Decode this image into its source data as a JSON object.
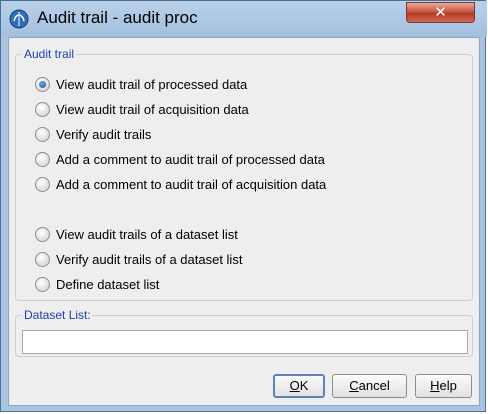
{
  "window": {
    "title": "Audit trail - audit proc",
    "close_label": "✕"
  },
  "audit_group": {
    "title": "Audit trail",
    "options": [
      {
        "label": "View audit trail of processed data",
        "selected": true
      },
      {
        "label": "View audit trail of acquisition data",
        "selected": false
      },
      {
        "label": "Verify audit trails",
        "selected": false
      },
      {
        "label": "Add a comment to audit trail of processed data",
        "selected": false
      },
      {
        "label": "Add a comment to audit trail of acquisition data",
        "selected": false
      },
      {
        "label": "View audit trails of a dataset list",
        "selected": false
      },
      {
        "label": "Verify audit trails of a dataset list",
        "selected": false
      },
      {
        "label": "Define dataset list",
        "selected": false
      }
    ]
  },
  "dataset_list": {
    "title": "Dataset List:",
    "value": ""
  },
  "buttons": {
    "ok": {
      "first": "O",
      "rest": "K"
    },
    "cancel": {
      "first": "C",
      "rest": "ancel"
    },
    "help": {
      "first": "H",
      "rest": "elp"
    }
  },
  "colors": {
    "group_title": "#1f3fb0",
    "frame": "#a8c4e0",
    "close_button": "#c85844"
  }
}
